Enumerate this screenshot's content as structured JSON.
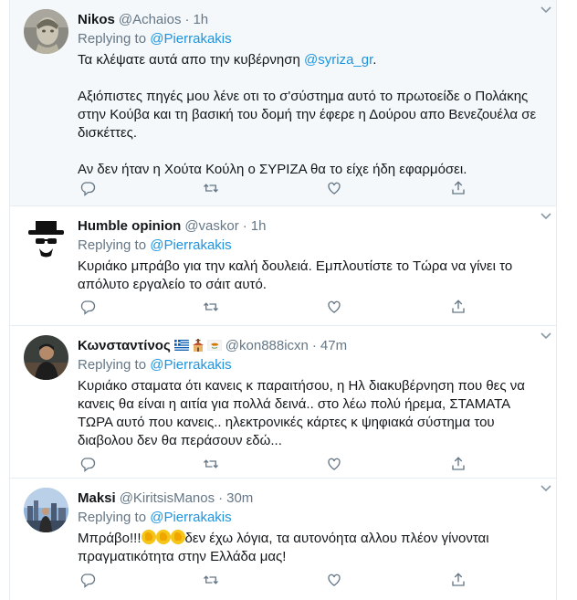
{
  "tweets": [
    {
      "name": "Nikos",
      "handle": "@Achaios",
      "time": "1h",
      "replying_prefix": "Replying to ",
      "replying_to": "@Pierrakakis",
      "text_p1_a": "Τα κλέψατε αυτά απο την κυβέρνηση ",
      "text_p1_mention": "@syriza_gr",
      "text_p1_b": ".",
      "text_p2": "Αξιόπιστες πηγές μου λένε οτι το σ'σύστημα αυτό το πρωτοείδε ο Πολάκης στην Κούβα και τη βασική του δομή την έφερε η Δούρου απο Βενεζουέλα σε δισκέττες.",
      "text_p3": "Αν δεν ήταν η Χούτα Κούλη ο ΣΥΡΙΖΑ θα το είχε ήδη εφαρμόσει."
    },
    {
      "name": "Humble opinion",
      "handle": "@vaskor",
      "time": "1h",
      "replying_prefix": "Replying to ",
      "replying_to": "@Pierrakakis",
      "text": "Κυριάκο μπράβο για την καλή δουλειά. Εμπλουτίστε το Τώρα να γίνει το απόλυτο εργαλείο το σάιτ αυτό."
    },
    {
      "name": "Κωνσταντίνος",
      "handle": "@kon888icxn",
      "time": "47m",
      "replying_prefix": "Replying to ",
      "replying_to": "@Pierrakakis",
      "text": "Κυριάκο σταματα ότι κανεις κ παραιτήσου, η Ηλ διακυβέρνηση που θες να κανεις θα είναι η αιτία για πολλά δεινά.. στο λέω πολύ ήρεμα, ΣΤΑΜΑΤΑ ΤΩΡΑ αυτό που κανεις.. ηλεκτρονικές κάρτες κ ψηφιακά σύστημα του διαβολου δεν θα περάσουν εδώ..."
    },
    {
      "name": "Maksi",
      "handle": "@KiritsisManos",
      "time": "30m",
      "replying_prefix": "Replying to ",
      "replying_to": "@Pierrakakis",
      "text_a": "Μπράβο!!!",
      "text_b": "δεν έχω λόγια, τα αυτονόητα αλλου πλέον γίνονται πραγματικότητα στην Ελλάδα μας!"
    }
  ],
  "separator": "·",
  "icons": {
    "reply": "reply-icon",
    "retweet": "retweet-icon",
    "like": "like-icon",
    "share": "share-icon",
    "more": "chevron-down-icon",
    "clap": "clapping-hands-emoji"
  },
  "colors": {
    "link": "#1b95e0",
    "secondary": "#657786",
    "highlight_bg": "#f5f8fa",
    "border": "#e6ecf0"
  }
}
